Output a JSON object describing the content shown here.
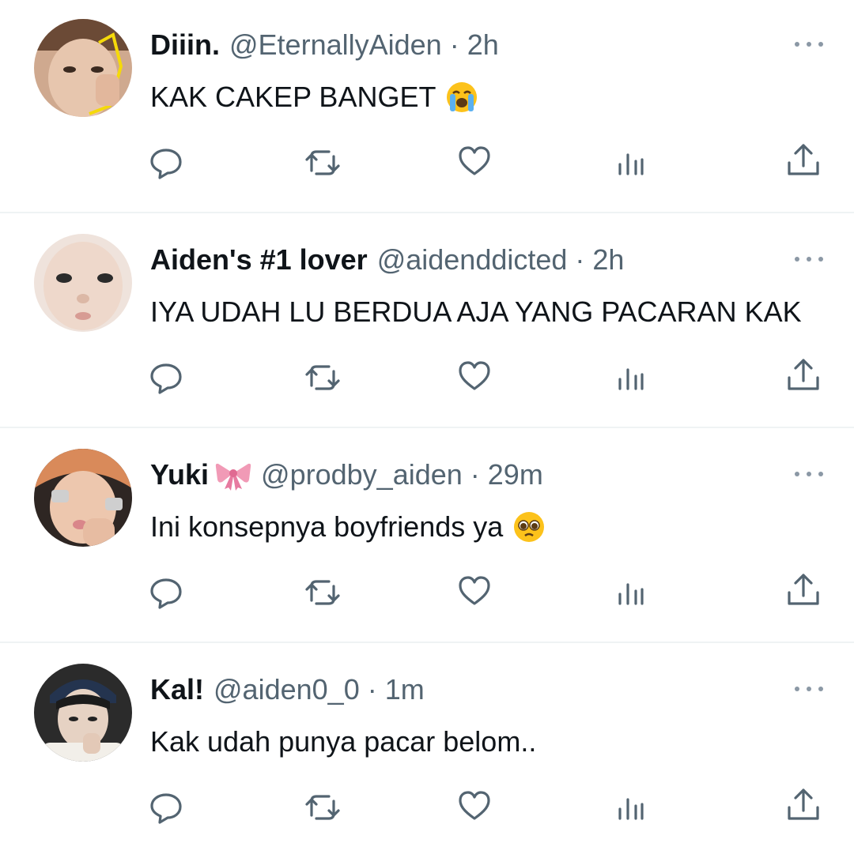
{
  "tweets": [
    {
      "name": "Diiin.",
      "handle": "@EternallyAiden",
      "time": "2h",
      "text": "KAK CAKEP BANGET",
      "emoji": "loudly-crying-face",
      "avatar_color": "#d9b8a0"
    },
    {
      "name": "Aiden's #1 lover",
      "handle": "@aidenddicted",
      "time": "2h",
      "text": "IYA UDAH LU BERDUA AJA YANG PACARAN KAK",
      "emoji": "",
      "avatar_color": "#e8d6cc"
    },
    {
      "name": "Yuki",
      "handle": "@prodby_aiden",
      "time": "29m",
      "text": "Ini konsepnya boyfriends ya",
      "emoji": "pleading-face",
      "badge": "ribbon",
      "avatar_color": "#e0b59a"
    },
    {
      "name": "Kal!",
      "handle": "@aiden0_0",
      "time": "1m",
      "text": "Kak udah punya pacar belom..",
      "emoji": "",
      "avatar_color": "#3a3a3a"
    }
  ],
  "separator": " · ",
  "colors": {
    "icon": "#536471",
    "name": "#0f1419",
    "muted": "#536471",
    "divider": "#eff3f4"
  },
  "icons": [
    "reply-icon",
    "retweet-icon",
    "like-icon",
    "views-icon",
    "share-icon",
    "more-icon"
  ]
}
